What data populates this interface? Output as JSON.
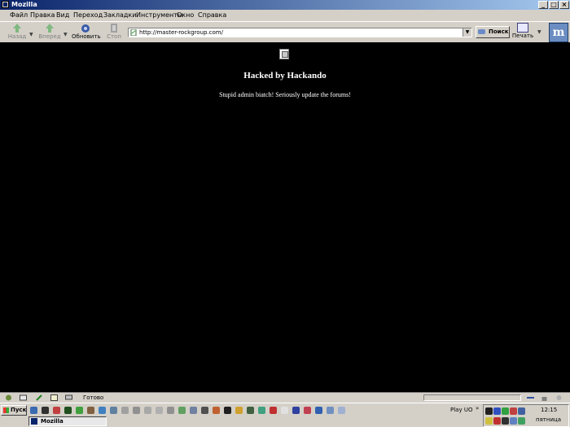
{
  "window": {
    "title": "Mozilla"
  },
  "menu": [
    "Файл",
    "Правка",
    "Вид",
    "Переход",
    "Закладки",
    "Инструменты",
    "Окно",
    "Справка"
  ],
  "toolbar": {
    "back_label": "Назад",
    "forward_label": "Вперед",
    "reload_label": "Обновить",
    "stop_label": "Стоп",
    "url_value": "http://master-rockgroup.com/",
    "search_label": "Поиск",
    "print_label": "Печать",
    "brand_letter": "m"
  },
  "page": {
    "heading": "Hacked by Hackando",
    "text": "Stupid admin biatch! Seriously update the forums!"
  },
  "statusbar": {
    "text": "Готово"
  },
  "taskbar": {
    "start_label": "Пуск",
    "active_window": "Mozilla",
    "tray_label": "Play UO",
    "clock": "12:15",
    "day": "пятница"
  },
  "colors": {
    "page_background": "#000000",
    "page_text": "#ffffff",
    "chrome": "#d4d0c8",
    "titlebar_start": "#0a246a",
    "titlebar_end": "#a6caf0"
  }
}
